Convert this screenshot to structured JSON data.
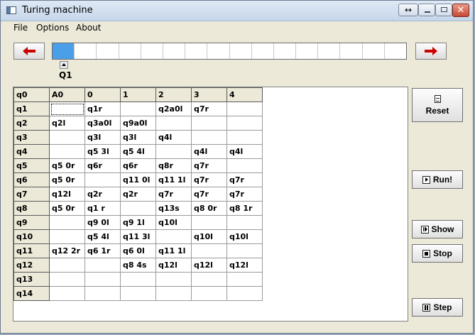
{
  "window": {
    "title": "Turing machine",
    "resize_glyph": "↔",
    "close_glyph": "✕"
  },
  "menu": [
    "File",
    "Options",
    "About"
  ],
  "tape": {
    "cell_count": 16,
    "head_index": 0,
    "head_state": "Q1",
    "active_color": "#4a9fe8"
  },
  "nav": {
    "left_arrow_icon": "red-left-arrow-icon",
    "right_arrow_icon": "red-right-arrow-icon",
    "arrow_color": "#cc0000"
  },
  "table": {
    "headers": [
      "q0",
      "A0",
      "0",
      "1",
      "2",
      "3",
      "4"
    ],
    "rows": [
      {
        "state": "q1",
        "cells": [
          "",
          "q1r",
          "",
          "q2a0l",
          "q7r",
          ""
        ]
      },
      {
        "state": "q2",
        "cells": [
          "q2l",
          "q3a0l",
          "q9a0l",
          "",
          "",
          ""
        ]
      },
      {
        "state": "q3",
        "cells": [
          "",
          "q3l",
          "q3l",
          "q4l",
          "",
          ""
        ]
      },
      {
        "state": "q4",
        "cells": [
          "",
          "q5 3l",
          "q5 4l",
          "",
          "q4l",
          "q4l"
        ]
      },
      {
        "state": "q5",
        "cells": [
          "q5 0r",
          "q6r",
          "q6r",
          "q8r",
          "q7r",
          ""
        ]
      },
      {
        "state": "q6",
        "cells": [
          "q5 0r",
          "",
          "q11 0l",
          "q11 1l",
          "q7r",
          "q7r"
        ]
      },
      {
        "state": "q7",
        "cells": [
          "q12l",
          "q2r",
          "q2r",
          "q7r",
          "q7r",
          "q7r"
        ]
      },
      {
        "state": "q8",
        "cells": [
          "q5 0r",
          "q1 r",
          "",
          "q13s",
          "q8 0r",
          "q8 1r"
        ]
      },
      {
        "state": "q9",
        "cells": [
          "",
          "q9 0l",
          "q9 1l",
          "q10l",
          "",
          ""
        ]
      },
      {
        "state": "q10",
        "cells": [
          "",
          "q5 4l",
          "q11 3l",
          "",
          "q10l",
          "q10l"
        ]
      },
      {
        "state": "q11",
        "cells": [
          "q12 2r",
          "q6 1r",
          "q6 0l",
          "q11 1l",
          "",
          ""
        ]
      },
      {
        "state": "q12",
        "cells": [
          "",
          "",
          "q8 4s",
          "q12l",
          "q12l",
          "q12l"
        ]
      },
      {
        "state": "q13",
        "cells": [
          "",
          "",
          "",
          "",
          "",
          ""
        ]
      },
      {
        "state": "q14",
        "cells": [
          "",
          "",
          "",
          "",
          "",
          ""
        ]
      }
    ]
  },
  "buttons": {
    "reset": "Reset",
    "run": "Run!",
    "show": "Show",
    "stop": "Stop",
    "step": "Step"
  }
}
